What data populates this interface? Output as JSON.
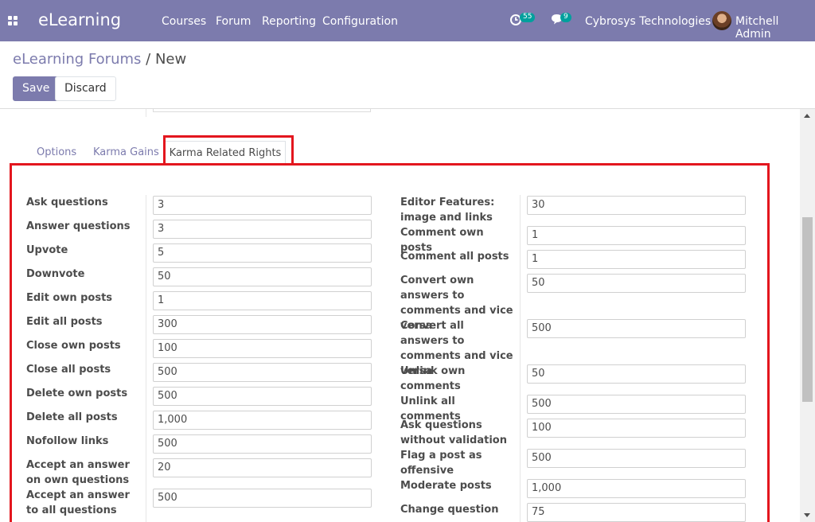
{
  "navbar": {
    "brand": "eLearning",
    "menu": [
      "Courses",
      "Forum",
      "Reporting",
      "Configuration"
    ],
    "activity_count": "55",
    "message_count": "9",
    "company": "Cybrosys Technologies",
    "user": "Mitchell Admin",
    "bg_color": "#7c7bad"
  },
  "breadcrumb": {
    "parent": "eLearning Forums",
    "separator": "/",
    "current": "New"
  },
  "buttons": {
    "save": "Save",
    "discard": "Discard"
  },
  "tabs": [
    "Options",
    "Karma Gains",
    "Karma Related Rights"
  ],
  "left_fields": [
    {
      "label": "Ask questions",
      "value": "3"
    },
    {
      "label": "Answer questions",
      "value": "3"
    },
    {
      "label": "Upvote",
      "value": "5"
    },
    {
      "label": "Downvote",
      "value": "50"
    },
    {
      "label": "Edit own posts",
      "value": "1"
    },
    {
      "label": "Edit all posts",
      "value": "300"
    },
    {
      "label": "Close own posts",
      "value": "100"
    },
    {
      "label": "Close all posts",
      "value": "500"
    },
    {
      "label": "Delete own posts",
      "value": "500"
    },
    {
      "label": "Delete all posts",
      "value": "1,000"
    },
    {
      "label": "Nofollow links",
      "value": "500"
    },
    {
      "label": "Accept an answer on own questions",
      "value": "20"
    },
    {
      "label": "Accept an answer to all questions",
      "value": "500"
    }
  ],
  "right_fields": [
    {
      "label": "Editor Features: image and links",
      "value": "30"
    },
    {
      "label": "Comment own posts",
      "value": "1"
    },
    {
      "label": "Comment all posts",
      "value": "1"
    },
    {
      "label": "Convert own answers to comments and vice versa",
      "value": "50"
    },
    {
      "label": "Convert all answers to comments and vice versa",
      "value": "500"
    },
    {
      "label": "Unlink own comments",
      "value": "50"
    },
    {
      "label": "Unlink all comments",
      "value": "500"
    },
    {
      "label": "Ask questions without validation",
      "value": "100"
    },
    {
      "label": "Flag a post as offensive",
      "value": "500"
    },
    {
      "label": "Moderate posts",
      "value": "1,000"
    },
    {
      "label": "Change question",
      "value": "75"
    }
  ],
  "highlight_color": "#e3161e"
}
